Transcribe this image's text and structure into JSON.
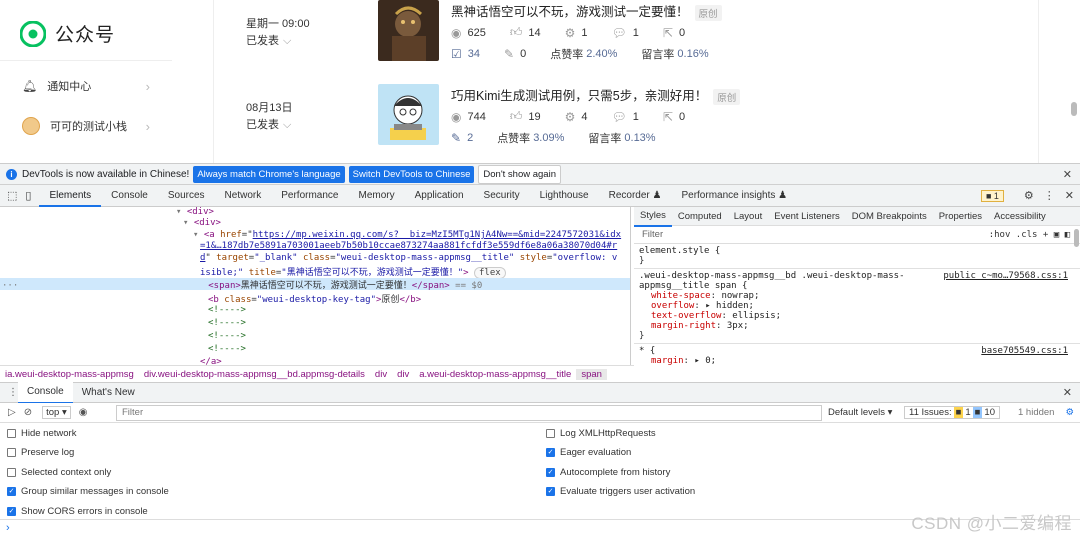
{
  "wx": {
    "logo": "公众号",
    "nav": [
      {
        "label": "通知中心"
      },
      {
        "label": "可可的测试小栈"
      }
    ],
    "posts": [
      {
        "date": "星期一 09:00",
        "state": "已发表",
        "title": "黑神话悟空可以不玩，游戏测试一定要懂！",
        "tag": "原创",
        "reads": "625",
        "likes": "14",
        "shares": "1",
        "comments": "1",
        "favs": "0",
        "wow": "34",
        "edits": "0",
        "like_rate_label": "点赞率",
        "like_rate": "2.40%",
        "comment_rate_label": "留言率",
        "comment_rate": "0.16%"
      },
      {
        "date": "08月13日",
        "state": "已发表",
        "title": "巧用Kimi生成测试用例，只需5步，亲测好用！",
        "tag": "原创",
        "reads": "744",
        "likes": "19",
        "shares": "4",
        "comments": "1",
        "favs": "0",
        "edits": "2",
        "like_rate_label": "点赞率",
        "like_rate": "3.09%",
        "comment_rate_label": "留言率",
        "comment_rate": "0.13%"
      }
    ]
  },
  "devtools": {
    "infobar": {
      "message": "DevTools is now available in Chinese!",
      "btn_match": "Always match Chrome's language",
      "btn_switch": "Switch DevTools to Chinese",
      "btn_dont": "Don't show again"
    },
    "tabs": [
      "Elements",
      "Console",
      "Sources",
      "Network",
      "Performance",
      "Memory",
      "Application",
      "Security",
      "Lighthouse",
      "Recorder ♟",
      "Performance insights ♟"
    ],
    "warn_count": "1",
    "elements": {
      "l1": "<div>",
      "l2": "<div>",
      "a_href_url": "https://mp.weixin.qq.com/s?__biz=MzI5MTg1NjA4Nw==&mid=2247572031&idx",
      "a_href_cont": "=1&…187db7e5891a703001aeeb7b50b10ccae873274aa881fcfdf3e559df6e8a06a38070d04#r",
      "a_href_end": "d",
      "a_target": "\"_blank\"",
      "a_class": "\"weui-desktop-mass-appmsg__title\"",
      "a_style": "\"overflow: v",
      "a_style_cont": "isible;\"",
      "a_title": "\"黑神话悟空可以不玩，游戏测试一定要懂！\"",
      "flex": "flex",
      "span_text": "黑神话悟空可以不玩，游戏测试一定要懂！",
      "span_eq": "== $0",
      "b_class": "\"weui-desktop-key-tag\"",
      "b_text": "原创",
      "comment": "<!---->",
      "close_a": "</a>"
    },
    "breadcrumb": [
      "ia.weui-desktop-mass-appmsg",
      "div.weui-desktop-mass-appmsg__bd.appmsg-details",
      "div",
      "div",
      "a.weui-desktop-mass-appmsg__title",
      "span"
    ],
    "styles": {
      "tabs": [
        "Styles",
        "Computed",
        "Layout",
        "Event Listeners",
        "DOM Breakpoints",
        "Properties",
        "Accessibility"
      ],
      "filter": "Filter",
      "tools": ":hov  .cls  +",
      "rule0_selector": "element.style {",
      "rule1_selector": ".weui-desktop-mass-appmsg__bd .weui-desktop-mass-",
      "rule1_selector2": "appmsg__title span {",
      "rule1_src": "public_c~mo…79568.css:1",
      "rule1_props": [
        {
          "name": "white-space",
          "value": "nowrap;"
        },
        {
          "name": "overflow",
          "value": "▸ hidden;"
        },
        {
          "name": "text-overflow",
          "value": "ellipsis;"
        },
        {
          "name": "margin-right",
          "value": "3px;"
        }
      ],
      "rule2_selector": "* {",
      "rule2_src": "base705549.css:1",
      "rule2_prop": {
        "name": "margin",
        "value": "▸ 0;"
      }
    },
    "drawer": {
      "tabs": [
        "Console",
        "What's New"
      ],
      "context": "top ▾",
      "filter": "Filter",
      "levels": "Default levels ▾",
      "issues_label": "11 Issues:",
      "issues_warn": "1",
      "issues_info": "10",
      "hidden": "1 hidden",
      "settings_left": [
        {
          "label": "Hide network",
          "checked": false
        },
        {
          "label": "Preserve log",
          "checked": false
        },
        {
          "label": "Selected context only",
          "checked": false
        },
        {
          "label": "Group similar messages in console",
          "checked": true
        },
        {
          "label": "Show CORS errors in console",
          "checked": true
        }
      ],
      "settings_right": [
        {
          "label": "Log XMLHttpRequests",
          "checked": false
        },
        {
          "label": "Eager evaluation",
          "checked": true
        },
        {
          "label": "Autocomplete from history",
          "checked": true
        },
        {
          "label": "Evaluate triggers user activation",
          "checked": true
        }
      ]
    }
  },
  "watermark": "CSDN @小二爱编程",
  "colors": {
    "accent": "#1a73e8",
    "wx_link": "#576b95",
    "selection": "#cfe8fc"
  }
}
